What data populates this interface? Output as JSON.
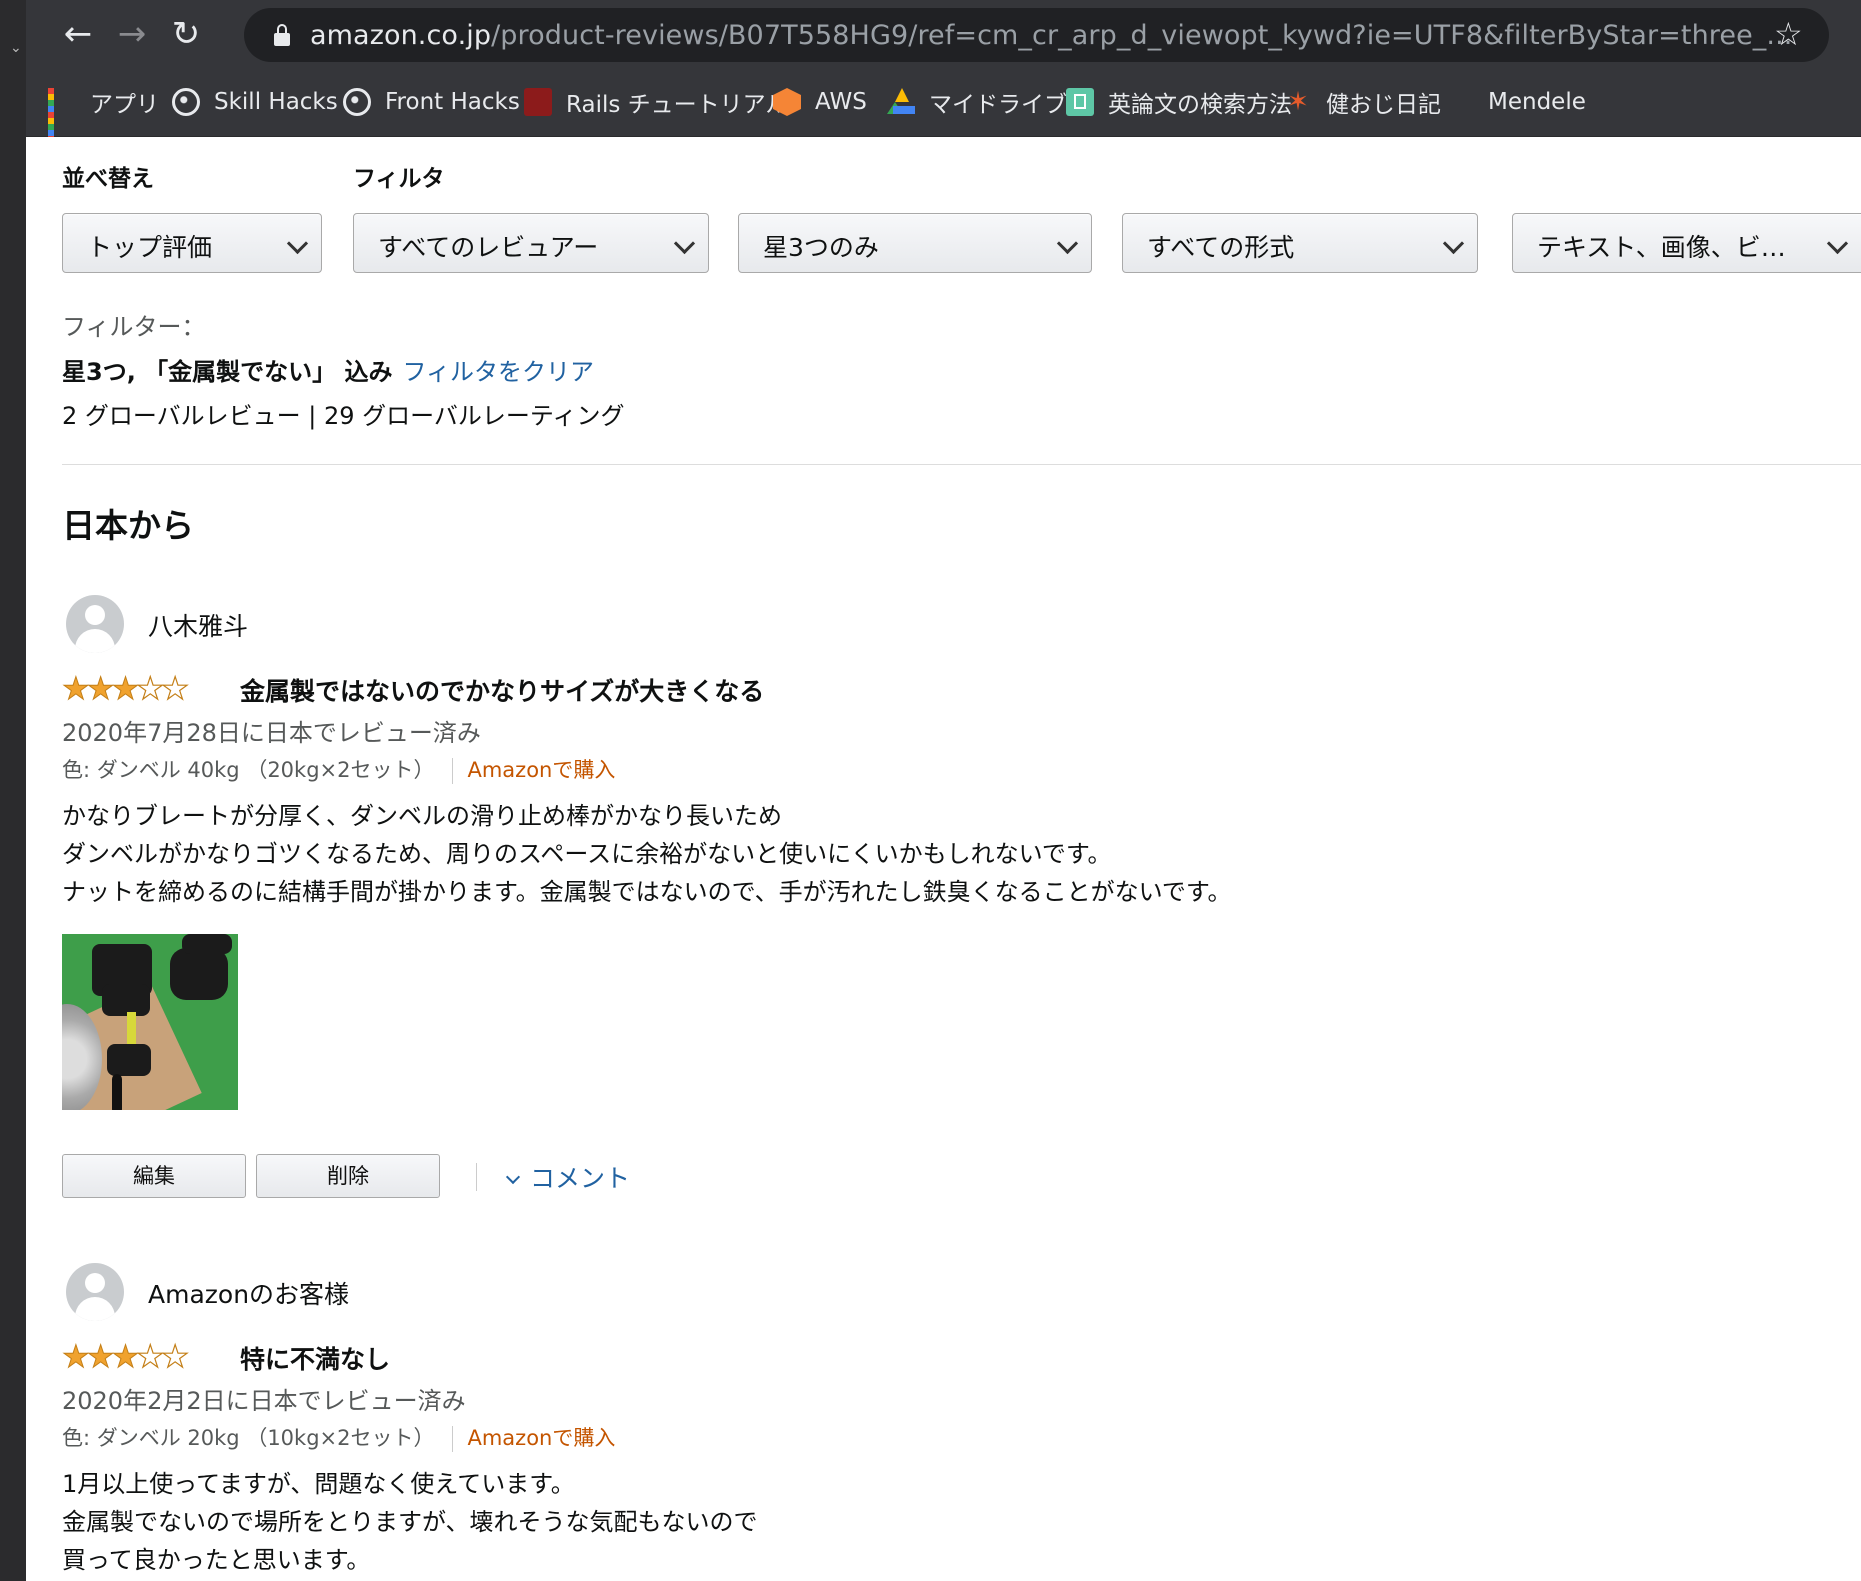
{
  "browser": {
    "url_host": "amazon.co.jp",
    "url_path": "/product-reviews/B07T558HG9/ref=cm_cr_arp_d_viewopt_kywd?ie=UTF8&filterByStar=three_...",
    "bookmarks": [
      {
        "label": "アプリ",
        "icon": "apps-icon"
      },
      {
        "label": "Skill Hacks",
        "icon": "globe-icon"
      },
      {
        "label": "Front Hacks",
        "icon": "globe-icon"
      },
      {
        "label": "Rails チュートリアル",
        "icon": "rails-icon"
      },
      {
        "label": "AWS",
        "icon": "aws-icon"
      },
      {
        "label": "マイドライブ",
        "icon": "google-drive-icon"
      },
      {
        "label": "英論文の検索方法",
        "icon": "notebook-icon"
      },
      {
        "label": "健おじ日記",
        "icon": "runner-icon"
      },
      {
        "label": "Mendele",
        "icon": "mendeley-icon"
      }
    ]
  },
  "filters": {
    "sort_label": "並べ替え",
    "filter_label": "フィルタ",
    "dropdowns": [
      "トップ評価",
      "すべてのレビュアー",
      "星3つのみ",
      "すべての形式",
      "テキスト、画像、ビ…"
    ],
    "applied_label": "フィルター：",
    "applied_text": "星3つ, 「金属製でない」 込み",
    "clear_link": "フィルタをクリア",
    "counts": "2 グローバルレビュー | 29 グローバルレーティング"
  },
  "section_title": "日本から",
  "reviews": [
    {
      "reviewer": "八木雅斗",
      "rating": 3,
      "title": "金属製ではないのでかなりサイズが大きくなる",
      "date": "2020年7月28日に日本でレビュー済み",
      "variant": "色: ダンベル 40kg （20kg×2セット）",
      "verified": "Amazonで購入",
      "body": [
        "かなりブレートが分厚く、ダンベルの滑り止め棒がかなり長いため",
        "ダンベルがかなりゴツくなるため、周りのスペースに余裕がないと使いにくいかもしれないです。",
        "ナットを締めるのに結構手間が掛かります。金属製ではないので、手が汚れたし鉄臭くなることがないです。"
      ],
      "edit_label": "編集",
      "delete_label": "削除",
      "comment_label": "コメント"
    },
    {
      "reviewer": "Amazonのお客様",
      "rating": 3,
      "title": "特に不満なし",
      "date": "2020年2月2日に日本でレビュー済み",
      "variant": "色: ダンベル 20kg （10kg×2セット）",
      "verified": "Amazonで購入",
      "body": [
        "1月以上使ってますが、問題なく使えています。",
        "金属製でないので場所をとりますが、壊れそうな気配もないので",
        "買って良かったと思います。"
      ]
    }
  ],
  "colors": {
    "link": "#2162a1",
    "verified": "#c45500",
    "star": "#f0a22e",
    "browser_chrome": "#35363a"
  }
}
